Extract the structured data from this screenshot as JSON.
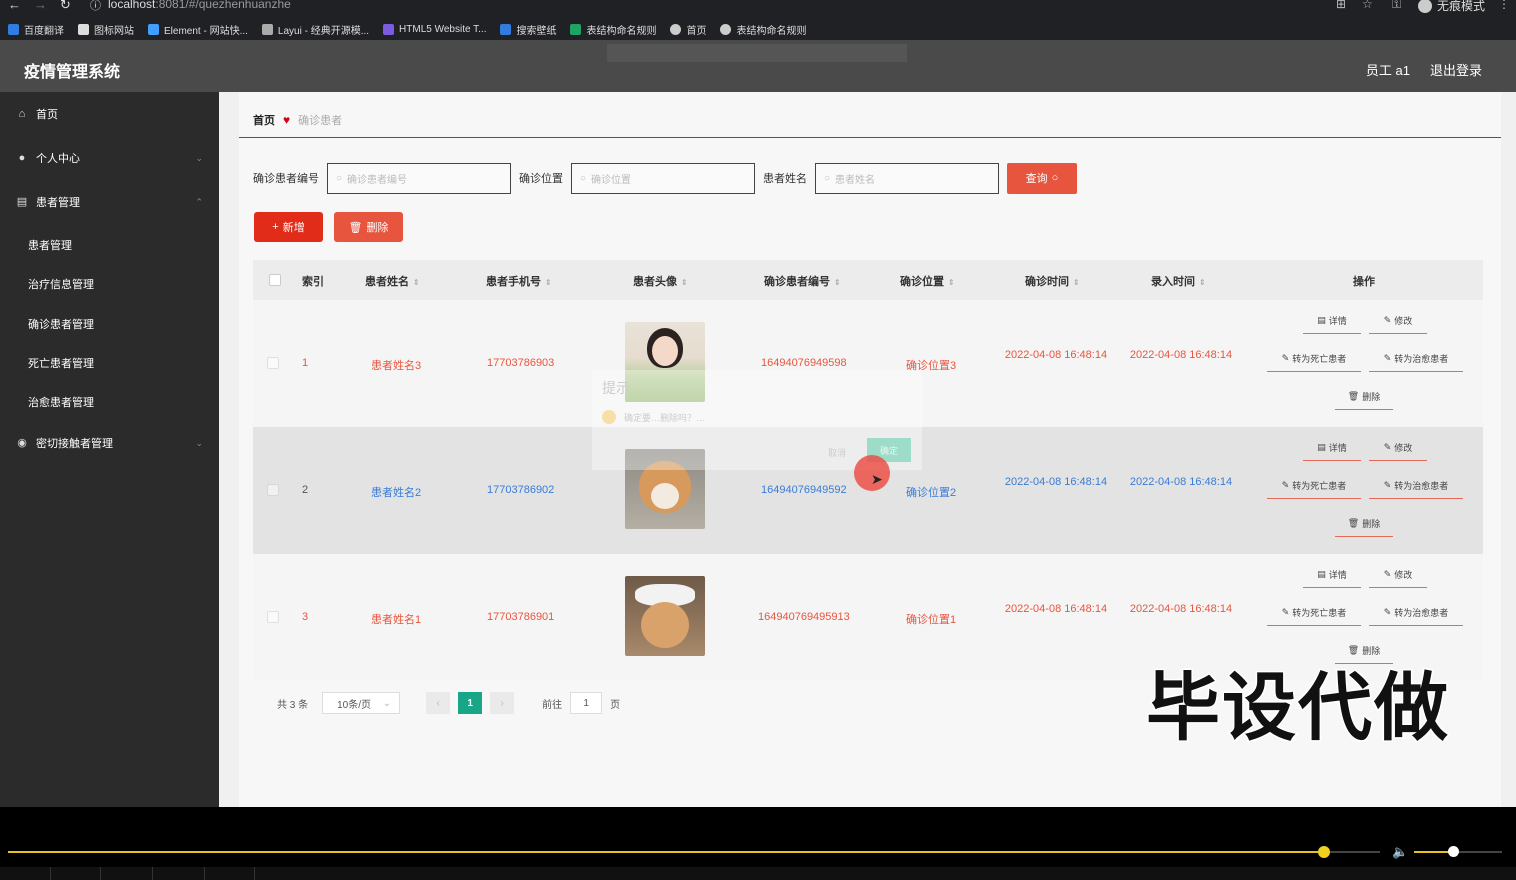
{
  "browser": {
    "url_host": "localhost",
    "url_path": ":8081/#/quezhenhuanzhe",
    "mode_label": "无痕模式",
    "bookmarks": [
      "百度翻译",
      "图标网站",
      "Element - 网站快...",
      "Layui - 经典开源模...",
      "HTML5 Website T...",
      "搜索壁纸",
      "表结构命名规则",
      "首页",
      "表结构命名规则"
    ]
  },
  "header": {
    "title": "疫情管理系统",
    "user": "员工 a1",
    "logout": "退出登录"
  },
  "sidebar": {
    "items": [
      {
        "label": "首页",
        "icon": "home-icon"
      },
      {
        "label": "个人中心",
        "icon": "user-icon"
      },
      {
        "label": "患者管理",
        "icon": "doc-icon"
      },
      {
        "label": "密切接触者管理",
        "icon": "pin-icon"
      }
    ],
    "sub_items": [
      "患者管理",
      "治疗信息管理",
      "确诊患者管理",
      "死亡患者管理",
      "治愈患者管理"
    ]
  },
  "breadcrumb": {
    "home": "首页",
    "current": "确诊患者"
  },
  "search": {
    "fields": [
      {
        "label": "确诊患者编号",
        "placeholder": "确诊患者编号"
      },
      {
        "label": "确诊位置",
        "placeholder": "确诊位置"
      },
      {
        "label": "患者姓名",
        "placeholder": "患者姓名"
      }
    ],
    "query_label": "查询"
  },
  "actions": {
    "add_label": "新增",
    "delete_label": "删除"
  },
  "table": {
    "headers": [
      "索引",
      "患者姓名",
      "患者手机号",
      "患者头像",
      "确诊患者编号",
      "确诊位置",
      "确诊时间",
      "录入时间",
      "操作"
    ],
    "rows": [
      {
        "index": "1",
        "name": "患者姓名3",
        "phone": "17703786903",
        "code": "16494076949598",
        "location": "确诊位置3",
        "confirm_time": "2022-04-08 16:48:14",
        "entry_time": "2022-04-08 16:48:14"
      },
      {
        "index": "2",
        "name": "患者姓名2",
        "phone": "17703786902",
        "code": "16494076949592",
        "location": "确诊位置2",
        "confirm_time": "2022-04-08 16:48:14",
        "entry_time": "2022-04-08 16:48:14"
      },
      {
        "index": "3",
        "name": "患者姓名1",
        "phone": "17703786901",
        "code": "16494076949591​3",
        "location": "确诊位置1",
        "confirm_time": "2022-04-08 16:48:14",
        "entry_time": "2022-04-08 16:48:14"
      }
    ],
    "ops": {
      "detail": "详情",
      "edit": "修改",
      "to_dead": "转为死亡患者",
      "to_cured": "转为治愈患者",
      "delete": "删除"
    }
  },
  "pager": {
    "total": "共 3 条",
    "page_size": "10条/页",
    "current": "1",
    "goto_prefix": "前往",
    "goto_value": "1",
    "goto_suffix": "页"
  },
  "dialog": {
    "title": "提示",
    "message": "确定要…删除吗？…",
    "cancel": "取消",
    "ok": "确定"
  },
  "watermark": "毕设代做",
  "colors": {
    "accent": "#e8553f",
    "brand_dark": "#2b2b2b",
    "pager_active": "#18a689",
    "progress": "#e6c21a"
  },
  "video": {
    "progress": 0.87,
    "volume": 0.45
  }
}
